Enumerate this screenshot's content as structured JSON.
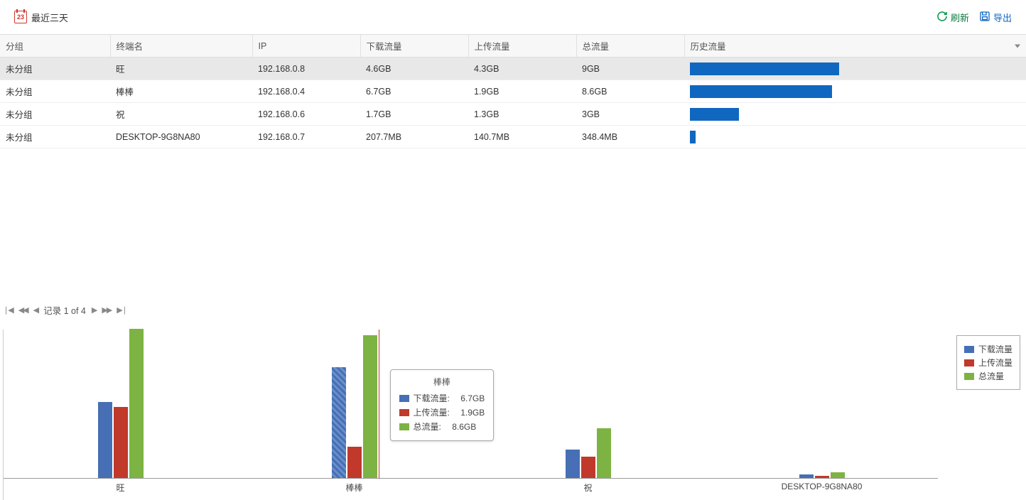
{
  "toolbar": {
    "date_day": "23",
    "date_label": "最近三天",
    "refresh": "刷新",
    "export": "导出"
  },
  "table": {
    "headers": {
      "group": "分组",
      "name": "终端名",
      "ip": "IP",
      "download": "下载流量",
      "upload": "上传流量",
      "total": "总流量",
      "history": "历史流量"
    },
    "rows": [
      {
        "group": "未分组",
        "name": "旺",
        "ip": "192.168.0.8",
        "download": "4.6GB",
        "upload": "4.3GB",
        "total": "9GB",
        "hist_pct": 100
      },
      {
        "group": "未分组",
        "name": "棒棒",
        "ip": "192.168.0.4",
        "download": "6.7GB",
        "upload": "1.9GB",
        "total": "8.6GB",
        "hist_pct": 95
      },
      {
        "group": "未分组",
        "name": "祝",
        "ip": "192.168.0.6",
        "download": "1.7GB",
        "upload": "1.3GB",
        "total": "3GB",
        "hist_pct": 33
      },
      {
        "group": "未分组",
        "name": "DESKTOP-9G8NA80",
        "ip": "192.168.0.7",
        "download": "207.7MB",
        "upload": "140.7MB",
        "total": "348.4MB",
        "hist_pct": 4
      }
    ]
  },
  "pager": {
    "label_prefix": "记录 ",
    "position": "1 of 4"
  },
  "legend": {
    "download": "下载流量",
    "upload": "上传流量",
    "total": "总流量"
  },
  "tooltip": {
    "title": "棒棒",
    "rows": [
      {
        "label": "下载流量:",
        "value": "6.7GB",
        "color": "#466fb5"
      },
      {
        "label": "上传流量:",
        "value": "1.9GB",
        "color": "#c0392b"
      },
      {
        "label": "总流量:",
        "value": "8.6GB",
        "color": "#7cb342"
      }
    ]
  },
  "chart_data": {
    "type": "bar",
    "categories": [
      "旺",
      "棒棒",
      "祝",
      "DESKTOP-9G8NA80"
    ],
    "series": [
      {
        "name": "下载流量",
        "values_gb": [
          4.6,
          6.7,
          1.7,
          0.203
        ],
        "color": "#466fb5"
      },
      {
        "name": "上传流量",
        "values_gb": [
          4.3,
          1.9,
          1.3,
          0.137
        ],
        "color": "#c0392b"
      },
      {
        "name": "总流量",
        "values_gb": [
          9.0,
          8.6,
          3.0,
          0.34
        ],
        "color": "#7cb342"
      }
    ],
    "ylim_gb": [
      0,
      9
    ],
    "hovered_index": 1
  }
}
